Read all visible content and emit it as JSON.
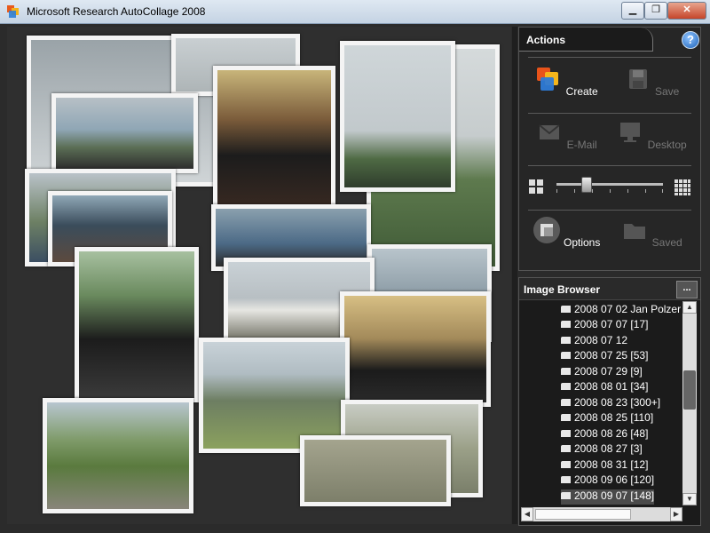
{
  "window": {
    "title": "Microsoft Research AutoCollage 2008",
    "controls": [
      "▁",
      "❐",
      "✕"
    ]
  },
  "actions": {
    "title": "Actions",
    "help": "?",
    "buttons": [
      {
        "label": "Create",
        "icon": "create-icon",
        "enabled": true
      },
      {
        "label": "Save",
        "icon": "floppy-icon",
        "enabled": false
      },
      {
        "label": "E-Mail",
        "icon": "email-icon",
        "enabled": false
      },
      {
        "label": "Desktop",
        "icon": "monitor-icon",
        "enabled": false
      },
      {
        "label": "Options",
        "icon": "options-icon",
        "enabled": true
      },
      {
        "label": "Saved",
        "icon": "folder-icon",
        "enabled": false
      }
    ],
    "size_slider": {
      "min_icon": "few-tiles-icon",
      "max_icon": "many-tiles-icon"
    }
  },
  "image_browser": {
    "title": "Image Browser",
    "more": "...",
    "items": [
      "2008 07 02 Jan Polzer",
      "2008 07 07  [17]",
      "2008 07 12",
      "2008 07 25  [53]",
      "2008 07 29  [9]",
      "2008 08 01  [34]",
      "2008 08 23 [300+]",
      "2008 08 25  [110]",
      "2008 08 26  [48]",
      "2008 08 27  [3]",
      "2008 08 31  [12]",
      "2008 09 06  [120]",
      "2008 09 07  [148]"
    ],
    "selected_index": 12
  },
  "colors": {
    "panel_bg": "#262626",
    "accent_blue": "#1d62b8"
  }
}
